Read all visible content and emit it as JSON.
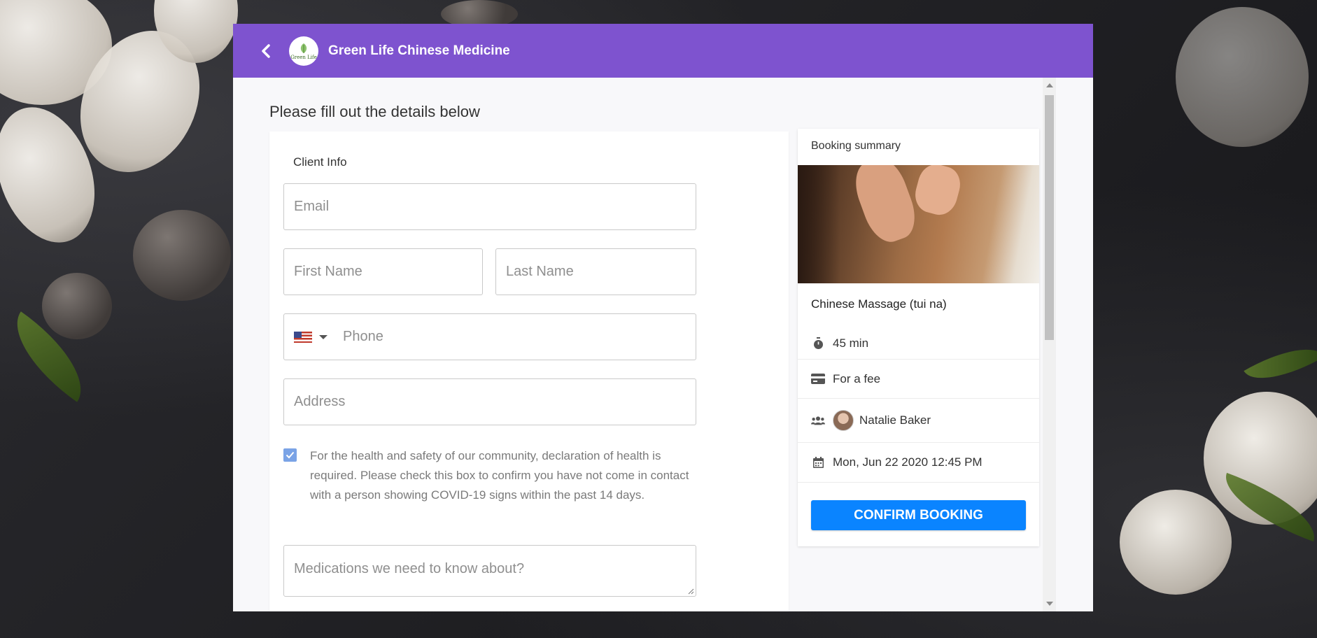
{
  "header": {
    "brand_name": "Green Life Chinese Medicine",
    "logo_text": "Green Life",
    "back_icon": "chevron-left-icon",
    "color": "#7e53cf"
  },
  "page": {
    "title": "Please fill out the details below"
  },
  "form": {
    "section_label": "Client Info",
    "email_placeholder": "Email",
    "first_name_placeholder": "First Name",
    "last_name_placeholder": "Last Name",
    "phone_placeholder": "Phone",
    "phone_country": "US",
    "address_placeholder": "Address",
    "consent_checked": true,
    "consent_text": "For the health and safety of our community, declaration of health is required. Please check this box to confirm you have not come in contact with a person showing COVID-19 signs within the past 14 days.",
    "medications_placeholder": "Medications we need to know about?"
  },
  "summary": {
    "title": "Booking summary",
    "service_name": "Chinese Massage (tui na)",
    "duration": "45 min",
    "price": "For a fee",
    "staff": "Natalie Baker",
    "datetime": "Mon, Jun 22 2020 12:45 PM",
    "confirm_label": "CONFIRM BOOKING",
    "confirm_color": "#0a84ff"
  }
}
